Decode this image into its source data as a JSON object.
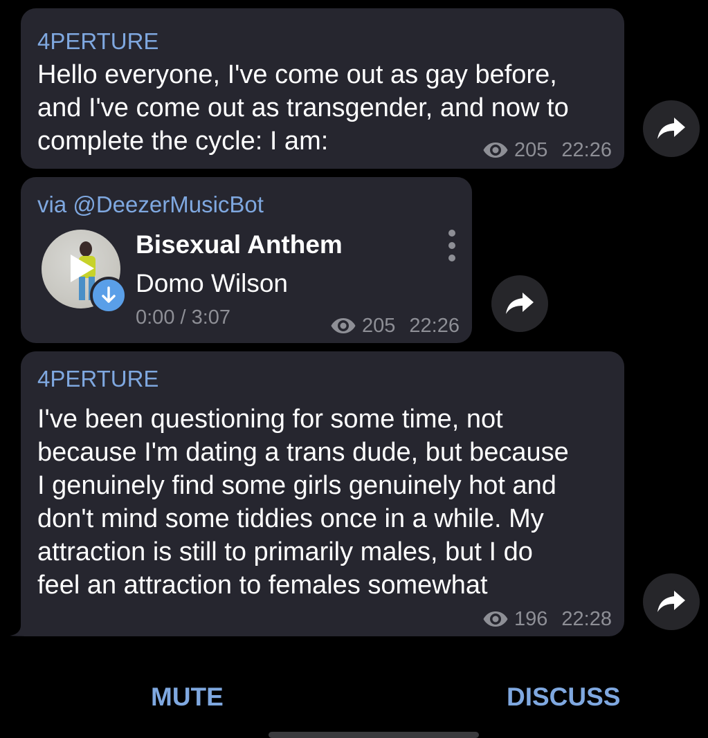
{
  "messages": [
    {
      "author": "4PERTURE",
      "text": "Hello everyone, I've come out as gay before,\nand I've come out as transgender, and now to\ncomplete the cycle: I am:",
      "views": "205",
      "time": "22:26"
    },
    {
      "via": "via @DeezerMusicBot",
      "track_title": "Bisexual Anthem",
      "track_artist": "Domo Wilson",
      "track_time": "0:00 / 3:07",
      "views": "205",
      "time": "22:26"
    },
    {
      "author": "4PERTURE",
      "text": "I've been questioning for some time, not\nbecause I'm dating a trans dude, but because\nI genuinely find some girls genuinely hot and\ndon't mind some tiddies once in a while. My\nattraction is still to primarily males, but I do\nfeel an attraction to females somewhat",
      "views": "196",
      "time": "22:28"
    }
  ],
  "bottom_bar": {
    "mute_label": "MUTE",
    "discuss_label": "DISCUSS"
  },
  "icons": {
    "views": "eye-icon",
    "share": "share-arrow-icon",
    "play": "play-icon",
    "download": "download-arrow-icon",
    "menu": "more-vertical-icon"
  },
  "colors": {
    "background": "#000000",
    "bubble": "#26262f",
    "accent": "#7fa8e0",
    "meta": "#8e8f96",
    "download_badge": "#5a9fe8"
  }
}
